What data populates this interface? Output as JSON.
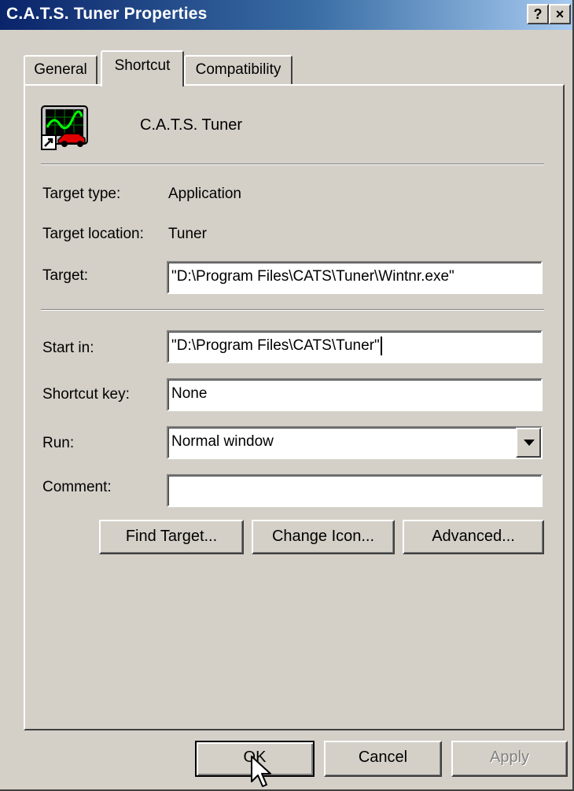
{
  "window": {
    "title": "C.A.T.S. Tuner Properties"
  },
  "titlebar": {
    "help_label": "?",
    "close_label": "×"
  },
  "tabs": [
    {
      "label": "General",
      "selected": false
    },
    {
      "label": "Shortcut",
      "selected": true
    },
    {
      "label": "Compatibility",
      "selected": false
    }
  ],
  "shortcut": {
    "icon": "cats-tuner-app-icon",
    "name": "C.A.T.S. Tuner",
    "target_type_label": "Target type:",
    "target_type_value": "Application",
    "target_location_label": "Target location:",
    "target_location_value": "Tuner",
    "target_label": "Target:",
    "target_value": "\"D:\\Program Files\\CATS\\Tuner\\Wintnr.exe\"",
    "start_in_label": "Start in:",
    "start_in_value": "\"D:\\Program Files\\CATS\\Tuner\"",
    "shortcut_key_label": "Shortcut key:",
    "shortcut_key_value": "None",
    "run_label": "Run:",
    "run_value": "Normal window",
    "comment_label": "Comment:",
    "comment_value": ""
  },
  "buttons": {
    "find_target": "Find Target...",
    "change_icon": "Change Icon...",
    "advanced": "Advanced...",
    "ok": "OK",
    "cancel": "Cancel",
    "apply": "Apply"
  },
  "colors": {
    "titlebar_start": "#0a246a",
    "titlebar_end": "#a6caf0",
    "face": "#d4d0c8"
  }
}
